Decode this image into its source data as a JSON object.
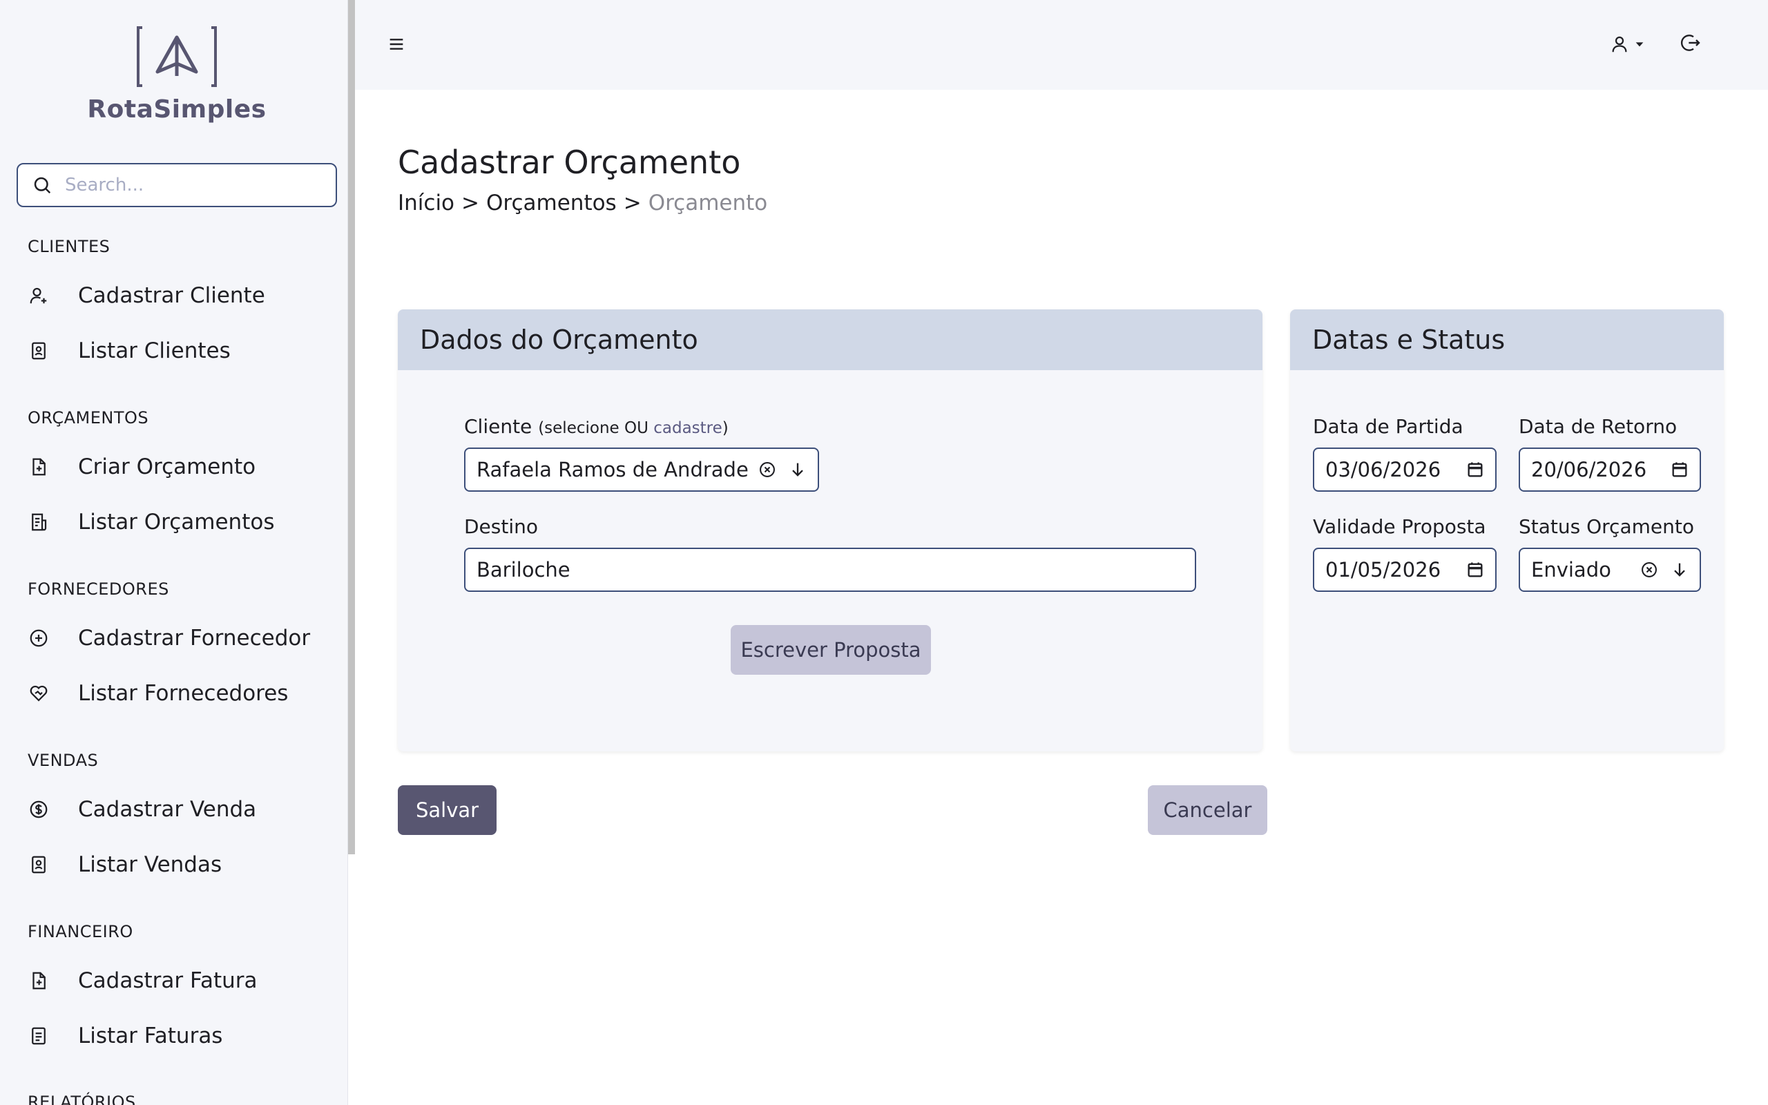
{
  "brand": {
    "name": "RotaSimples"
  },
  "search": {
    "placeholder": "Search..."
  },
  "sidebar": {
    "sections": [
      {
        "title": "CLIENTES",
        "items": [
          {
            "label": "Cadastrar Cliente",
            "icon": "user-plus-icon"
          },
          {
            "label": "Listar Clientes",
            "icon": "contact-book-icon"
          }
        ]
      },
      {
        "title": "ORÇAMENTOS",
        "items": [
          {
            "label": "Criar Orçamento",
            "icon": "file-plus-icon"
          },
          {
            "label": "Listar Orçamentos",
            "icon": "file-list-icon"
          }
        ]
      },
      {
        "title": "FORNECEDORES",
        "items": [
          {
            "label": "Cadastrar Fornecedor",
            "icon": "circle-plus-icon"
          },
          {
            "label": "Listar Fornecedores",
            "icon": "heart-handshake-icon"
          }
        ]
      },
      {
        "title": "VENDAS",
        "items": [
          {
            "label": "Cadastrar Venda",
            "icon": "dollar-circle-icon"
          },
          {
            "label": "Listar Vendas",
            "icon": "contact-book-icon"
          }
        ]
      },
      {
        "title": "FINANCEIRO",
        "items": [
          {
            "label": "Cadastrar Fatura",
            "icon": "file-plus-icon"
          },
          {
            "label": "Listar Faturas",
            "icon": "file-lines-icon"
          }
        ]
      },
      {
        "title": "RELATÓRIOS",
        "items": []
      }
    ]
  },
  "page": {
    "title": "Cadastrar Orçamento",
    "breadcrumb": [
      "Início",
      "Orçamentos",
      "Orçamento"
    ],
    "breadcrumb_separator": ">"
  },
  "card_dados": {
    "title": "Dados do Orçamento",
    "cliente_label": "Cliente",
    "cliente_hint_prefix": "(selecione OU ",
    "cliente_hint_link": "cadastre",
    "cliente_hint_suffix": ")",
    "cliente_value": "Rafaela Ramos de Andrade",
    "destino_label": "Destino",
    "destino_value": "Bariloche",
    "escrever_button": "Escrever Proposta"
  },
  "card_datas": {
    "title": "Datas e Status",
    "partida_label": "Data de Partida",
    "partida_value": "03/06/2026",
    "retorno_label": "Data de Retorno",
    "retorno_value": "20/06/2026",
    "validade_label": "Validade Proposta",
    "validade_value": "01/05/2026",
    "status_label": "Status Orçamento",
    "status_value": "Enviado"
  },
  "actions": {
    "save": "Salvar",
    "cancel": "Cancelar"
  },
  "colors": {
    "primary": "#585671",
    "secondary": "#c5c4d8",
    "card_header": "#d0d8e7",
    "sidebar_bg": "#f5f6fa",
    "input_border": "#3d4f7a"
  }
}
